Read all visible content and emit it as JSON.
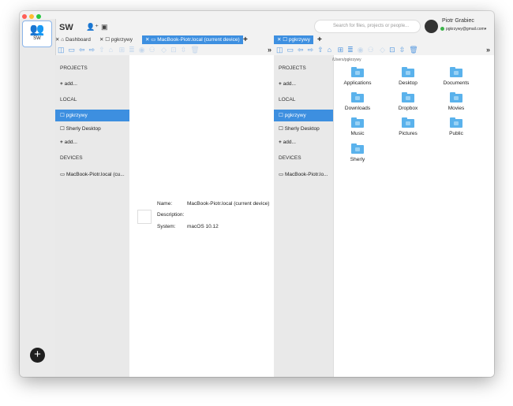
{
  "colors": {
    "accent": "#3d8fe0",
    "close": "#ff5f57",
    "minimize": "#febc2e",
    "zoom": "#28c840",
    "online": "#3cb34a"
  },
  "workspace": {
    "icon": "team-icon",
    "label": "SW"
  },
  "header": {
    "title": "SW",
    "search_placeholder": "Search for files, projects or people...",
    "user_name": "Piotr Grabiec",
    "user_email": "pgkrzywy@gmail.com"
  },
  "tabs": {
    "left": [
      {
        "label": "Dashboard",
        "icon": "home-icon"
      },
      {
        "label": "pgkrzywy",
        "icon": "folder-icon"
      },
      {
        "label": "MacBook-Piotr.local (current device)",
        "icon": "laptop-icon"
      }
    ],
    "right": [
      {
        "label": "pgkrzywy",
        "icon": "folder-icon"
      }
    ]
  },
  "sidebar": {
    "projects_title": "PROJECTS",
    "add_label": "add...",
    "local_title": "LOCAL",
    "local_items": [
      "pgkrzywy",
      "Sherly Desktop"
    ],
    "devices_title": "DEVICES",
    "device_left": "MacBook-Piotr.local (cu...",
    "device_right": "MacBook-Piotr.lo..."
  },
  "device_info": {
    "name_label": "Name:",
    "name_value": "MacBook-Piotr.local (current device)",
    "desc_label": "Description:",
    "desc_value": "",
    "system_label": "System:",
    "system_value": "macOS 10.12"
  },
  "files": {
    "path": "/Users/pgkrzywy",
    "items": [
      "Applications",
      "Desktop",
      "Documents",
      "Downloads",
      "Dropbox",
      "Movies",
      "Music",
      "Pictures",
      "Public",
      "Sherly"
    ]
  }
}
